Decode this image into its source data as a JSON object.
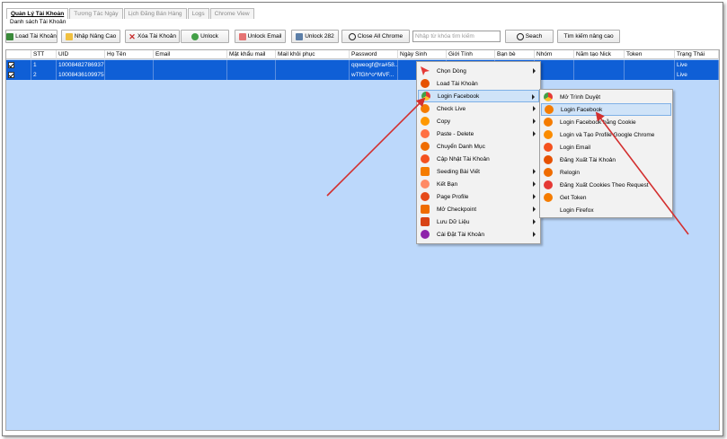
{
  "tabs": [
    {
      "label": "Quản Lý Tài Khoản",
      "active": true
    },
    {
      "label": "Tương Tác Ngày",
      "active": false
    },
    {
      "label": "Lịch Đăng Bán Hàng",
      "active": false
    },
    {
      "label": "Logs",
      "active": false
    },
    {
      "label": "Chrome View",
      "active": false
    }
  ],
  "subtitle": "Danh sách Tài Khoản",
  "toolbar": {
    "load": "Load Tài Khoản",
    "import": "Nhập Nâng Cao",
    "delete": "Xóa Tài Khoản",
    "unlock": "Unlock",
    "unlock_email": "Unlock Email",
    "unlock_282": "Unlock 282",
    "close_chrome": "Close All Chrome",
    "search_placeholder": "Nhập từ khóa tìm kiếm",
    "search": "Seach",
    "advanced_search": "Tìm kiếm nâng cao"
  },
  "table": {
    "columns": [
      "STT",
      "UID",
      "Họ Tên",
      "Email",
      "Mật khẩu mail",
      "Mail khôi phục",
      "Password",
      "Ngày Sinh",
      "Giới Tính",
      "Bạn bè",
      "Nhóm",
      "Năm tạo Nick",
      "Token",
      "Trạng Thái"
    ],
    "rows": [
      {
        "stt": "1",
        "uid": "100084827869379",
        "password": "qqweogf@ra#58...",
        "status": "Live"
      },
      {
        "stt": "2",
        "uid": "100084361099757",
        "password": "wTfGh^o^MVF...",
        "status": "Live"
      }
    ]
  },
  "context_menu": {
    "items": [
      {
        "label": "Chọn Dòng",
        "icon": "cursor-icon",
        "color": "#e53935",
        "submenu": true
      },
      {
        "label": "Load Tài Khoản",
        "icon": "refresh-icon",
        "color": "#e65100",
        "submenu": false
      },
      {
        "label": "Login Facebook",
        "icon": "chrome-icon",
        "color": "#fbc02d",
        "submenu": true
      },
      {
        "label": "Check Live",
        "icon": "check-circle-icon",
        "color": "#f57c00",
        "submenu": true
      },
      {
        "label": "Copy",
        "icon": "copy-icon",
        "color": "#ff9800",
        "submenu": true
      },
      {
        "label": "Paste - Delete",
        "icon": "paste-icon",
        "color": "#ff7043",
        "submenu": true
      },
      {
        "label": "Chuyển Danh Mục",
        "icon": "move-icon",
        "color": "#ef6c00",
        "submenu": false
      },
      {
        "label": "Cập Nhật Tài Khoản",
        "icon": "user-icon",
        "color": "#f4511e",
        "submenu": false
      },
      {
        "label": "Seeding Bài Viết",
        "icon": "comment-icon",
        "color": "#f57c00",
        "submenu": true
      },
      {
        "label": "Kết Bạn",
        "icon": "friends-icon",
        "color": "#ff8a65",
        "submenu": true
      },
      {
        "label": "Page Profile",
        "icon": "page-icon",
        "color": "#e64a19",
        "submenu": true
      },
      {
        "label": "Mở Checkpoint",
        "icon": "lock-icon",
        "color": "#ef6c00",
        "submenu": true
      },
      {
        "label": "Lưu Dữ Liệu",
        "icon": "save-icon",
        "color": "#d84315",
        "submenu": true
      },
      {
        "label": "Cài Đặt Tài Khoản",
        "icon": "settings-icon",
        "color": "#8e24aa",
        "submenu": true
      }
    ]
  },
  "submenu": {
    "items": [
      {
        "label": "Mở Trình Duyệt",
        "icon": "chrome-icon",
        "color": "#fbc02d"
      },
      {
        "label": "Login Facebook",
        "icon": "facebook-icon",
        "color": "#f57c00"
      },
      {
        "label": "Login Facebook bằng Cookie",
        "icon": "facebook-icon",
        "color": "#f57c00"
      },
      {
        "label": "Login và Tạo Profile Google Chrome",
        "icon": "google-icon",
        "color": "#fb8c00"
      },
      {
        "label": "Login Email",
        "icon": "user-icon",
        "color": "#f4511e"
      },
      {
        "label": "Đăng Xuất Tài Khoản",
        "icon": "logout-icon",
        "color": "#e65100"
      },
      {
        "label": "Relogin",
        "icon": "refresh-icon",
        "color": "#ef6c00"
      },
      {
        "label": "Đăng Xuất Cookies Theo Request",
        "icon": "cookie-icon",
        "color": "#e53935"
      },
      {
        "label": "Get Token",
        "icon": "token-icon",
        "color": "#f57c00"
      },
      {
        "label": "Login Firefox",
        "icon": "",
        "color": ""
      }
    ]
  },
  "colors": {
    "row_selected": "#0f5fd6",
    "grid_bg": "#bcd8fb",
    "arrow": "#d32f2f",
    "highlight": "#cfe3f8"
  }
}
